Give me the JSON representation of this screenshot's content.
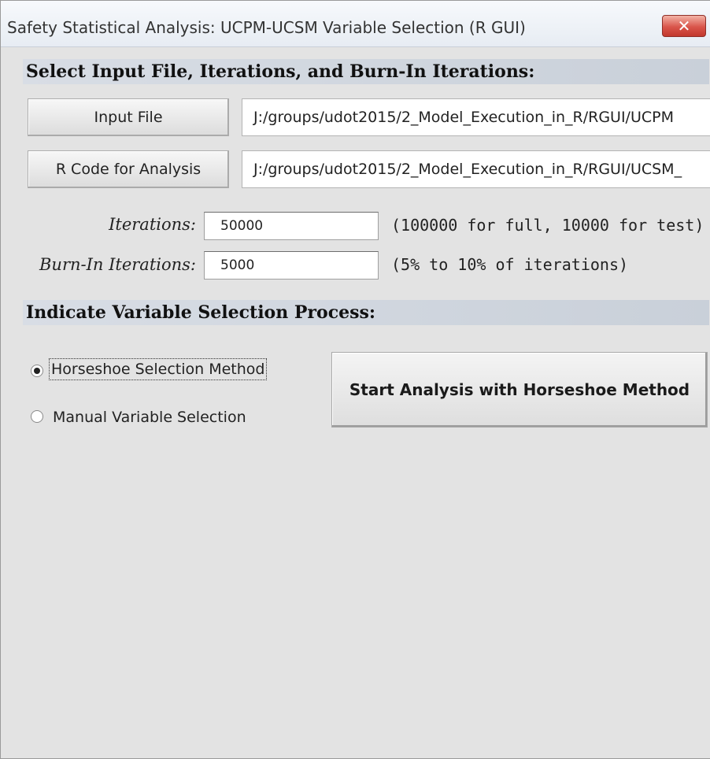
{
  "window": {
    "title": "Safety Statistical Analysis: UCPM-UCSM Variable Selection (R GUI)",
    "close_label": "✕"
  },
  "section_input": {
    "heading": "Select Input File, Iterations, and Burn-In Iterations:",
    "input_file_button": "Input File",
    "input_file_path": "J:/groups/udot2015/2_Model_Execution_in_R/RGUI/UCPM",
    "r_code_button": "R Code for Analysis",
    "r_code_path": "J:/groups/udot2015/2_Model_Execution_in_R/RGUI/UCSM_",
    "iterations_label": "Iterations:",
    "iterations_value": "50000",
    "iterations_hint": "(100000 for full, 10000 for test)",
    "burnin_label": "Burn-In Iterations:",
    "burnin_value": "5000",
    "burnin_hint": "(5% to 10% of iterations)"
  },
  "section_selection": {
    "heading": "Indicate Variable Selection Process:",
    "options": [
      {
        "label": "Horseshoe Selection Method",
        "selected": true
      },
      {
        "label": "Manual Variable Selection",
        "selected": false
      }
    ],
    "start_button": "Start Analysis with Horseshoe Method"
  }
}
